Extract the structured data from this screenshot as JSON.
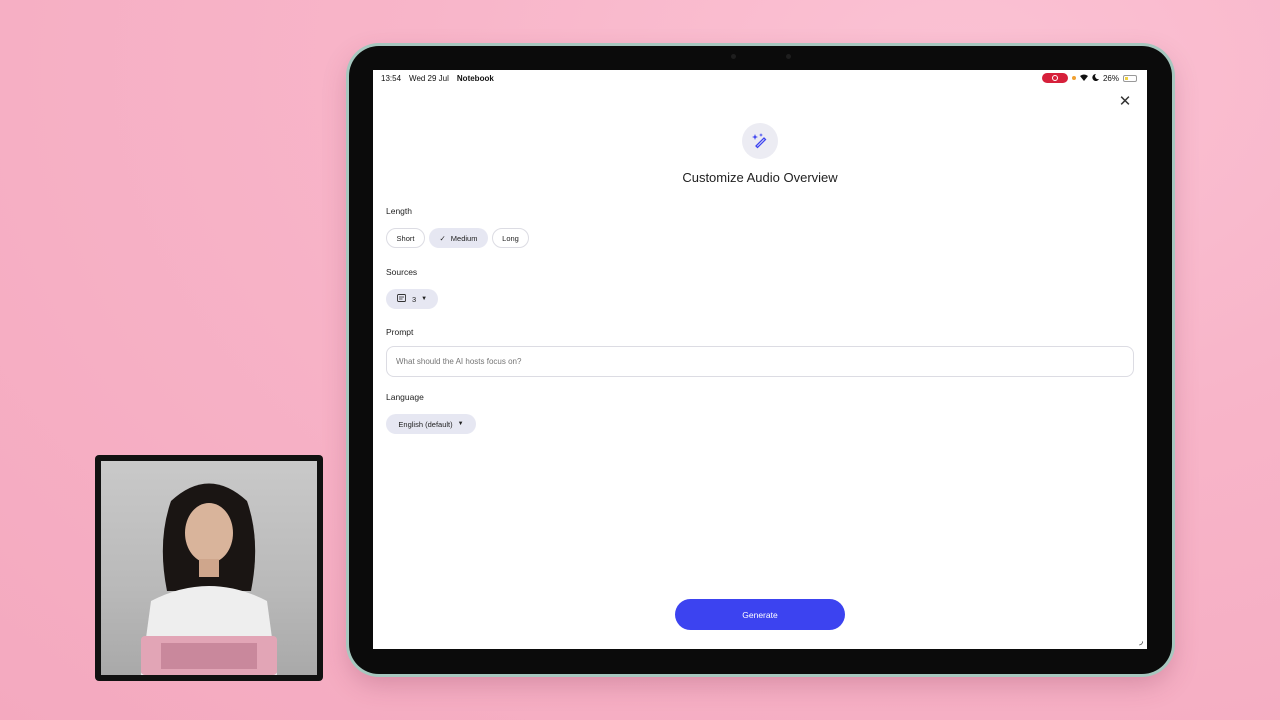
{
  "statusbar": {
    "time": "13:54",
    "date": "Wed 29 Jul",
    "app_name": "Notebook",
    "battery": "26%"
  },
  "dialog": {
    "title": "Customize Audio Overview",
    "icon": "magic-wand-sparkle-icon",
    "close_icon": "close-icon"
  },
  "length": {
    "label": "Length",
    "options": [
      "Short",
      "Medium",
      "Long"
    ],
    "selected": "Medium"
  },
  "sources": {
    "label": "Sources",
    "count": "3"
  },
  "prompt": {
    "label": "Prompt",
    "placeholder": "What should the AI hosts focus on?",
    "value": ""
  },
  "language": {
    "label": "Language",
    "selected": "English (default)"
  },
  "generate_label": "Generate",
  "colors": {
    "accent": "#3c43f0",
    "chip_selected": "#e6e7f2",
    "background_pink": "#f8b5c9",
    "record_red": "#d6203b"
  }
}
